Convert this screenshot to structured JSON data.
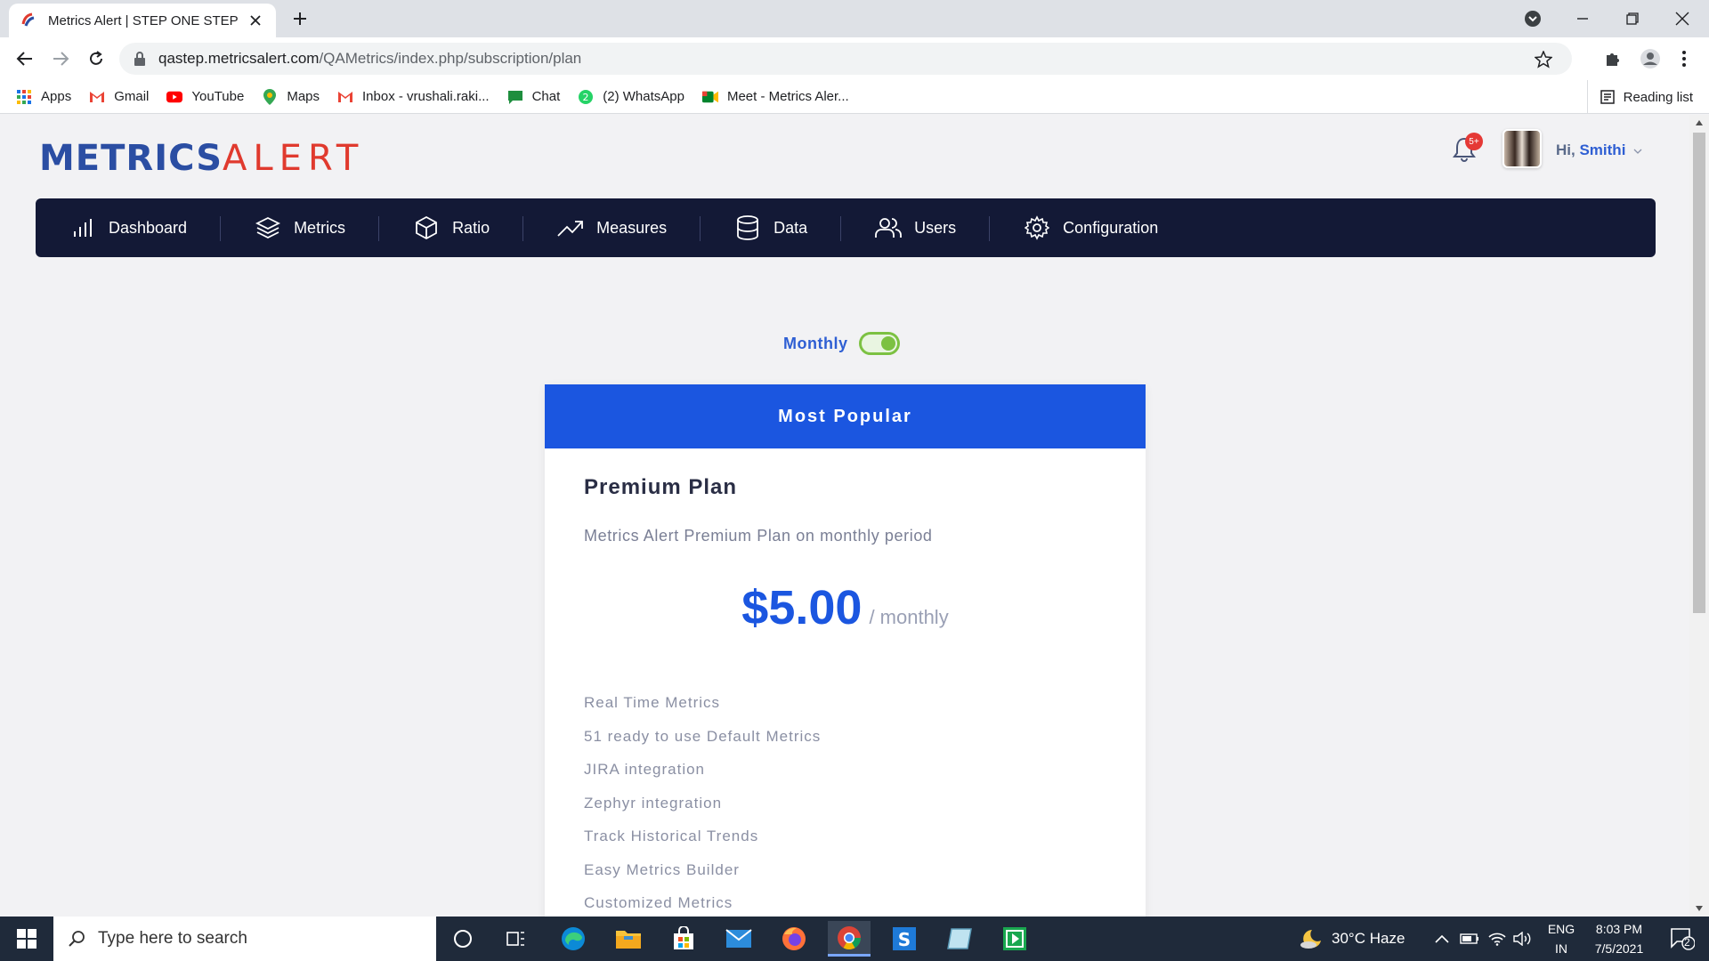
{
  "browser": {
    "tab_title": "Metrics Alert | STEP ONE STEP AHEAD",
    "url_host": "qastep.metricsalert.com",
    "url_path": "/QAMetrics/index.php/subscription/plan",
    "bookmarks": [
      {
        "label": "Apps",
        "icon": "apps-grid-icon"
      },
      {
        "label": "Gmail",
        "icon": "gmail-icon"
      },
      {
        "label": "YouTube",
        "icon": "youtube-icon"
      },
      {
        "label": "Maps",
        "icon": "maps-pin-icon"
      },
      {
        "label": "Inbox - vrushali.raki...",
        "icon": "gmail-icon"
      },
      {
        "label": "Chat",
        "icon": "chat-icon"
      },
      {
        "label": "(2) WhatsApp",
        "icon": "whatsapp-icon"
      },
      {
        "label": "Meet - Metrics Aler...",
        "icon": "meet-icon"
      }
    ],
    "reading_list": "Reading list"
  },
  "header": {
    "logo_part1": "METRICS",
    "logo_part2": "ALERT",
    "notification_badge": "5+",
    "greeting_hi": "Hi,",
    "greeting_name": "Smithi"
  },
  "nav": {
    "items": [
      {
        "label": "Dashboard",
        "icon": "bar-chart-icon"
      },
      {
        "label": "Metrics",
        "icon": "layers-icon"
      },
      {
        "label": "Ratio",
        "icon": "cube-icon"
      },
      {
        "label": "Measures",
        "icon": "trend-up-icon"
      },
      {
        "label": "Data",
        "icon": "database-icon"
      },
      {
        "label": "Users",
        "icon": "users-icon"
      },
      {
        "label": "Configuration",
        "icon": "gear-icon"
      }
    ]
  },
  "billing": {
    "toggle_label": "Monthly",
    "toggle_on": true
  },
  "plan": {
    "banner": "Most Popular",
    "name": "Premium Plan",
    "description": "Metrics Alert Premium Plan on monthly period",
    "price": "$5.00",
    "period": "/ monthly",
    "features": [
      "Real Time Metrics",
      "51 ready to use Default Metrics",
      "JIRA integration",
      "Zephyr integration",
      "Track Historical Trends",
      "Easy Metrics Builder",
      "Customized Metrics"
    ]
  },
  "taskbar": {
    "search_placeholder": "Type here to search",
    "weather": "30°C  Haze",
    "lang_top": "ENG",
    "lang_bottom": "IN",
    "time": "8:03 PM",
    "date": "7/5/2021",
    "notif_count": "2"
  },
  "colors": {
    "nav_bg": "#131936",
    "accent_blue": "#1b56e0",
    "logo_blue": "#2b4ea3",
    "logo_red": "#e03a2e",
    "toggle_green": "#7cc142"
  }
}
